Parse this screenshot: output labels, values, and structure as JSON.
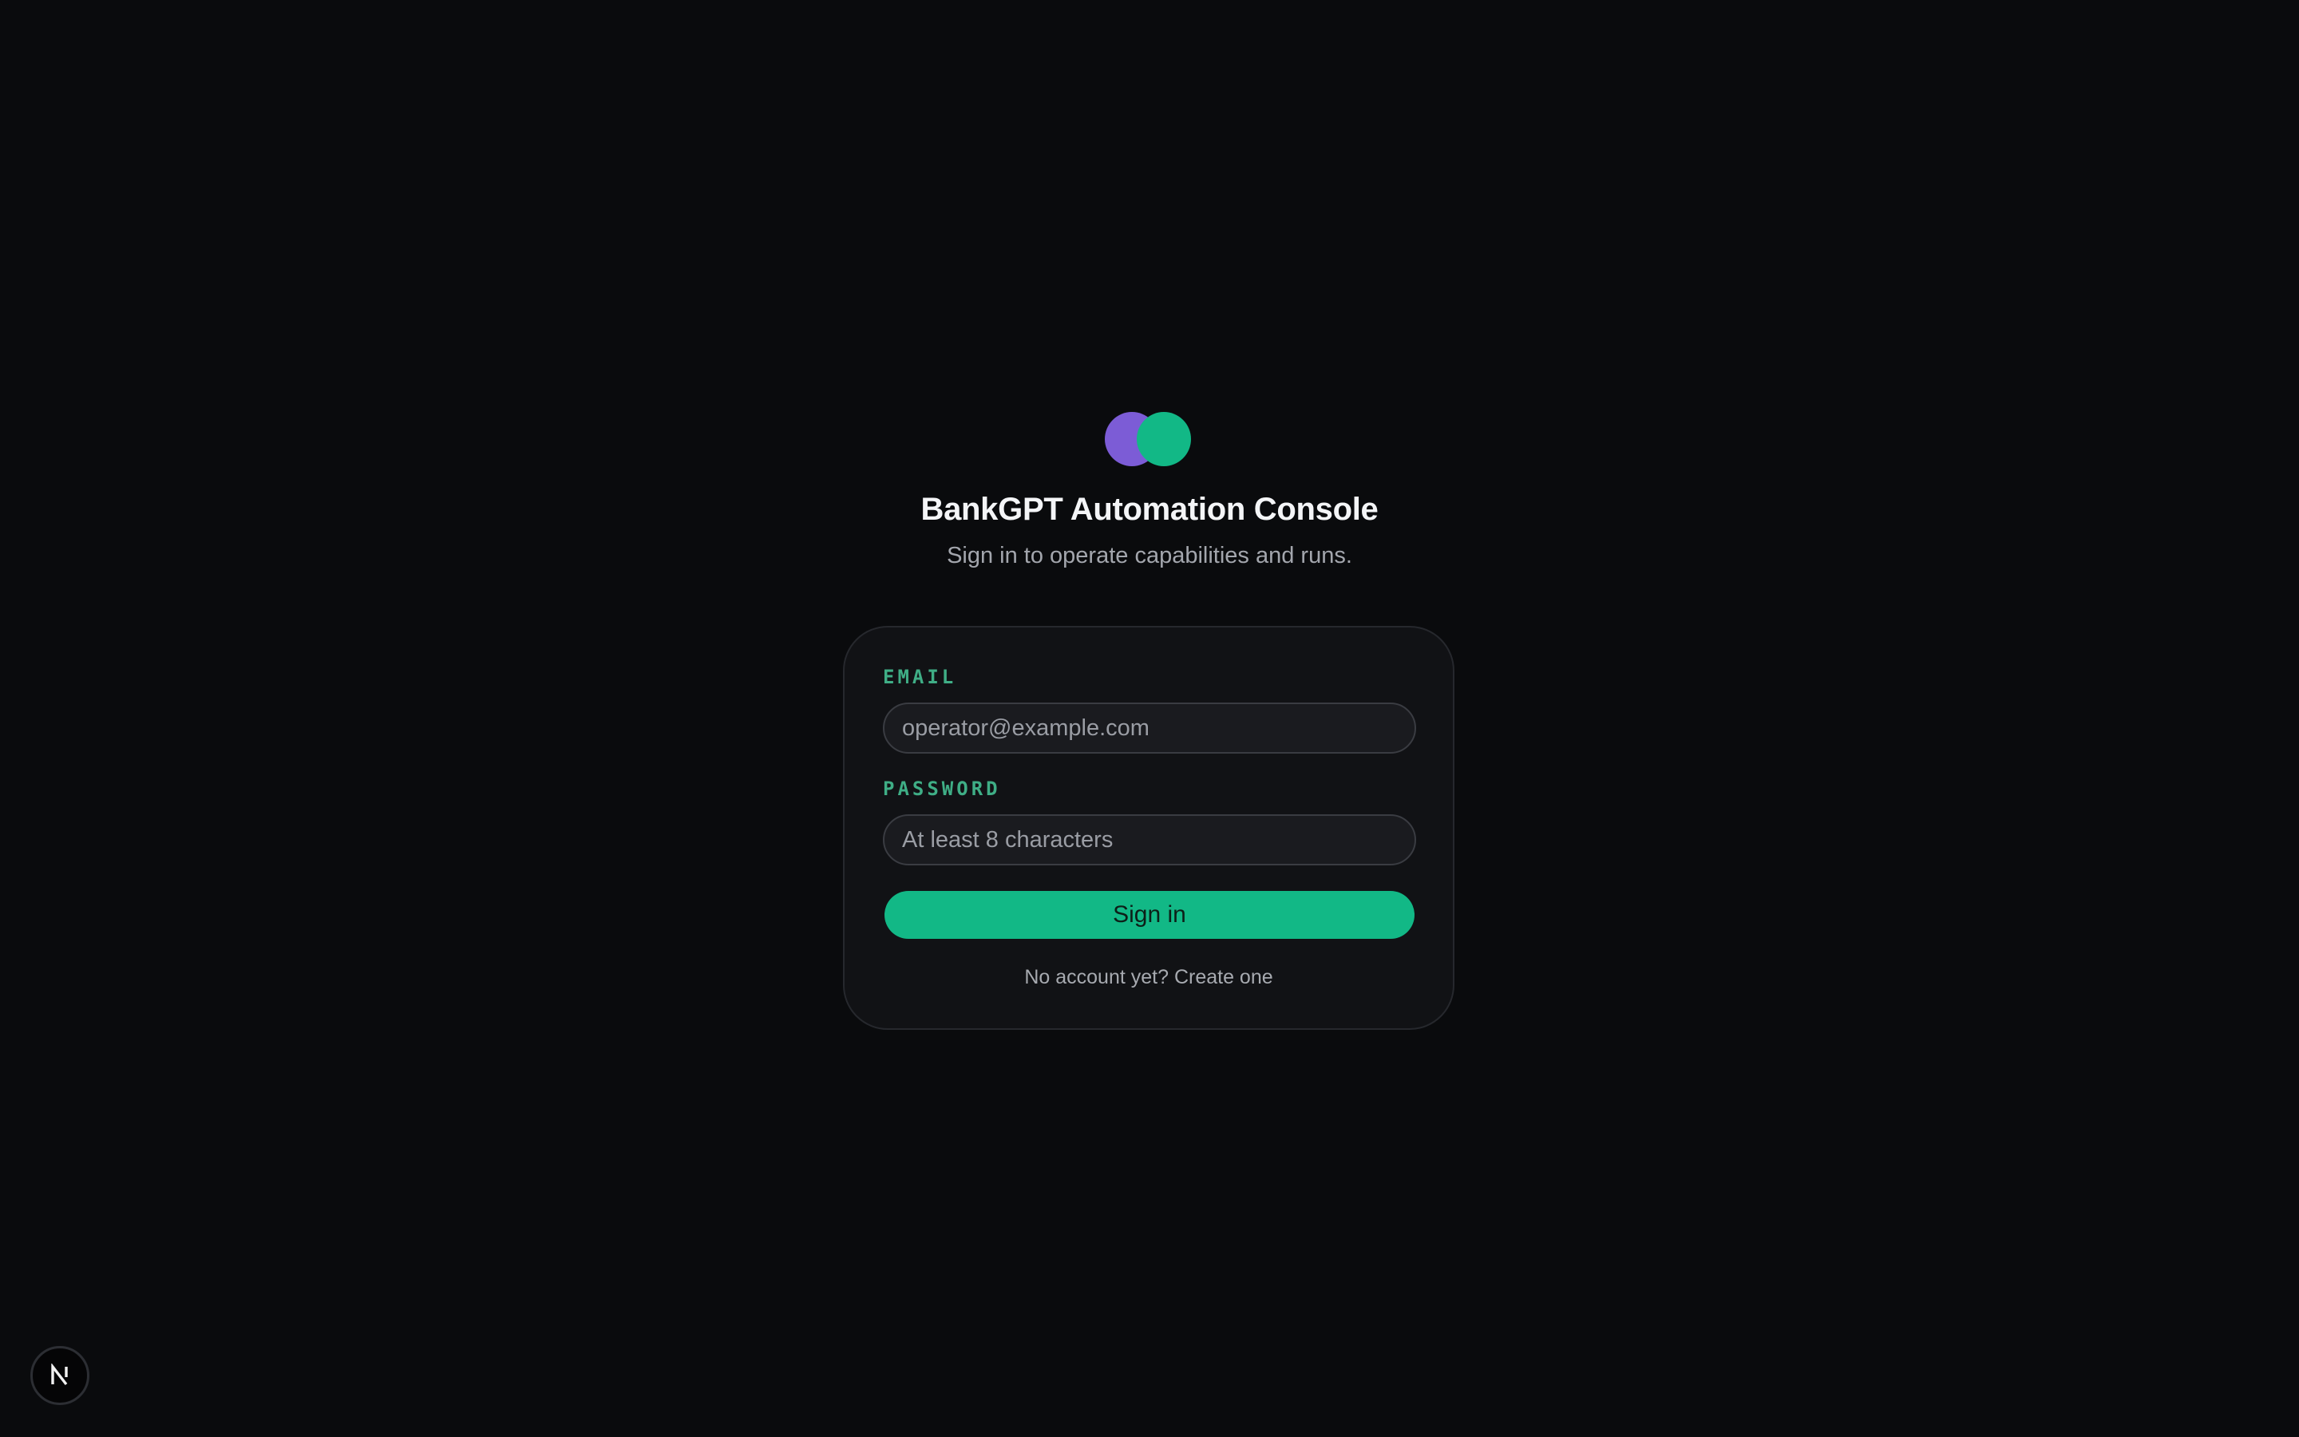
{
  "brand": {
    "title": "BankGPT Automation Console",
    "subtitle": "Sign in to operate capabilities and runs.",
    "logo_colors": {
      "left": "#7c5cd6",
      "right": "#12b886"
    }
  },
  "form": {
    "email": {
      "label": "EMAIL",
      "value": "",
      "placeholder": "operator@example.com"
    },
    "password": {
      "label": "PASSWORD",
      "value": "",
      "placeholder": "At least 8 characters"
    },
    "submit_label": "Sign in",
    "footer_text": "No account yet?",
    "footer_link": "Create one"
  },
  "colors": {
    "accent": "#12b886",
    "label": "#3fae86",
    "background": "#0a0b0d",
    "card": "#111215"
  },
  "dev_badge": {
    "icon": "nextjs-icon"
  }
}
